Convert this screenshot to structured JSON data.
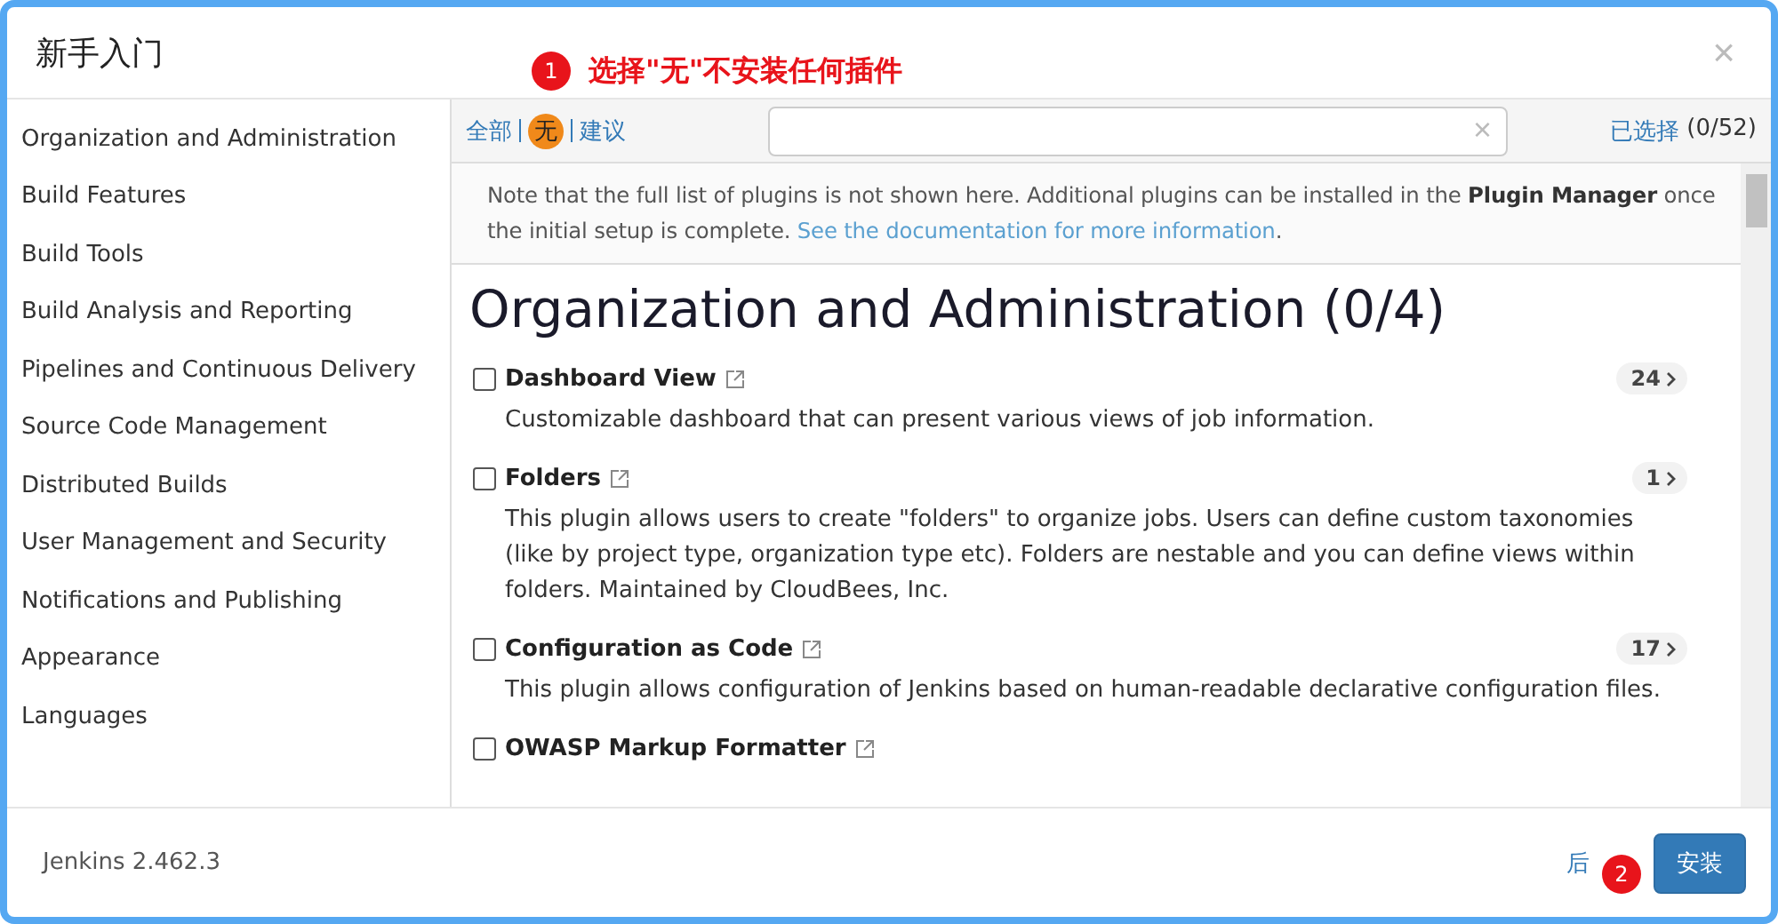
{
  "dialog": {
    "title": "新手入门",
    "close": "×"
  },
  "annotations": [
    {
      "number": "1",
      "text": "选择\"无\"不安装任何插件"
    },
    {
      "number": "2"
    }
  ],
  "sidebar": {
    "items": [
      {
        "label": "Organization and Administration",
        "selected": false
      },
      {
        "label": "Build Features",
        "selected": false
      },
      {
        "label": "Build Tools",
        "selected": false
      },
      {
        "label": "Build Analysis and Reporting",
        "selected": false
      },
      {
        "label": "Pipelines and Continuous Delivery",
        "selected": false
      },
      {
        "label": "Source Code Management",
        "selected": false
      },
      {
        "label": "Distributed Builds",
        "selected": false
      },
      {
        "label": "User Management and Security",
        "selected": false
      },
      {
        "label": "Notifications and Publishing",
        "selected": false
      },
      {
        "label": "Appearance",
        "selected": false
      },
      {
        "label": "Languages",
        "selected": false
      }
    ]
  },
  "toolbar": {
    "filters": [
      {
        "label": "全部",
        "selected": false
      },
      {
        "label": "无",
        "selected": true
      },
      {
        "label": "建议",
        "selected": false
      }
    ],
    "search": {
      "clear": "×"
    },
    "selected_link": "已选择",
    "selected_count": "(0/52)"
  },
  "notice": {
    "text": "Note that the full list of plugins is not shown here. Additional plugins can be installed in the **Plugin Manager** once the initial setup is complete.",
    "link": "See the documentation for more information",
    "end": "."
  },
  "section": {
    "heading": "Organization and Administration (0/4)",
    "plugins": [
      {
        "name": "Dashboard View",
        "checked": false,
        "dependencies": "24",
        "description": "Customizable dashboard that can present various views of job information."
      },
      {
        "name": "Folders",
        "checked": false,
        "dependencies": "1",
        "description": "This plugin allows users to create \"folders\" to organize jobs. Users can define custom taxonomies (like by project type, organization type etc). Folders are nestable and you can define views within folders. Maintained by CloudBees, Inc."
      },
      {
        "name": "Configuration as Code",
        "checked": false,
        "dependencies": "17",
        "description": "This plugin allows configuration of Jenkins based on human-readable declarative configuration files."
      },
      {
        "name": "OWASP Markup Formatter",
        "checked": false
      }
    ]
  },
  "footer": {
    "version": "Jenkins 2.462.3",
    "back": "后",
    "install": "安装"
  }
}
